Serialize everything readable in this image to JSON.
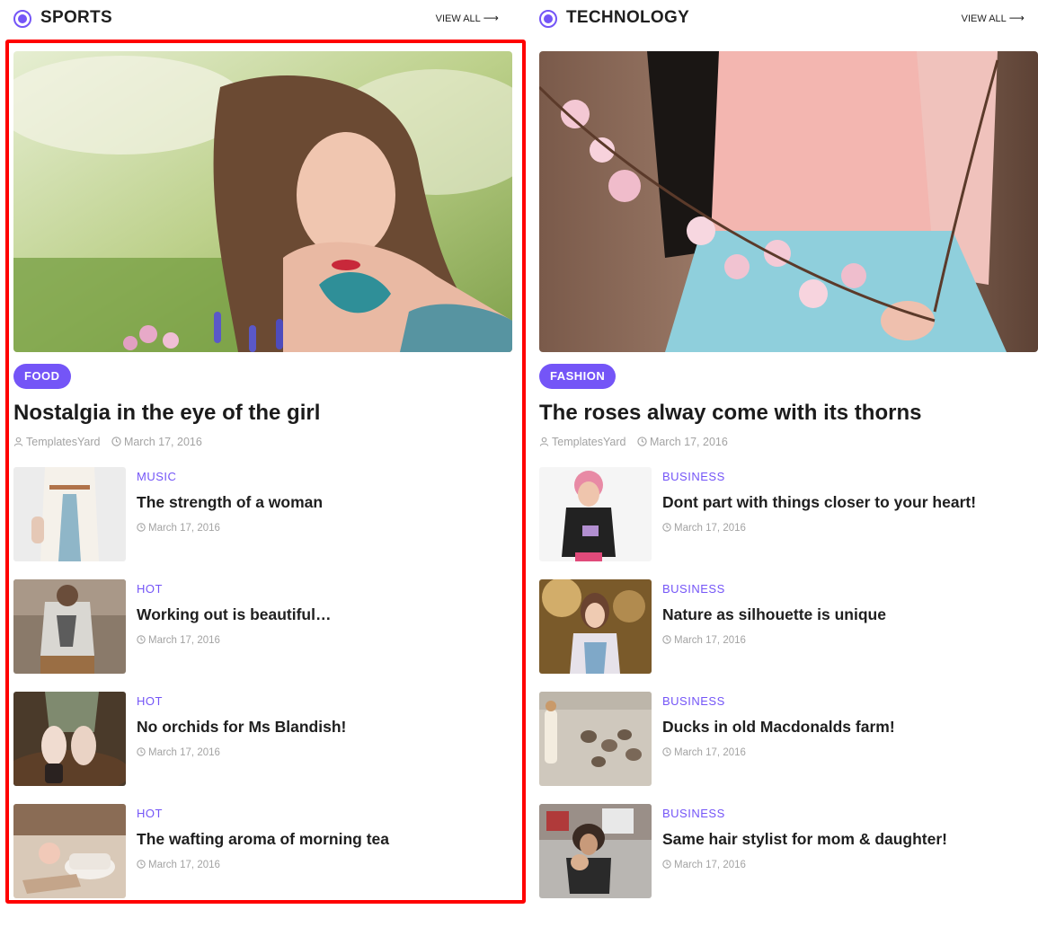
{
  "sections": [
    {
      "title": "SPORTS",
      "view_all": "VIEW ALL",
      "featured": {
        "category": "FOOD",
        "title": "Nostalgia in the eye of the girl",
        "author": "TemplatesYard",
        "date": "March 17, 2016"
      },
      "items": [
        {
          "category": "MUSIC",
          "title": "The strength of a woman",
          "date": "March 17, 2016"
        },
        {
          "category": "HOT",
          "title": "Working out is beautiful…",
          "date": "March 17, 2016"
        },
        {
          "category": "HOT",
          "title": "No orchids for Ms Blandish!",
          "date": "March 17, 2016"
        },
        {
          "category": "HOT",
          "title": "The wafting aroma of morning tea",
          "date": "March 17, 2016"
        }
      ]
    },
    {
      "title": "TECHNOLOGY",
      "view_all": "VIEW ALL",
      "featured": {
        "category": "FASHION",
        "title": "The roses alway come with its thorns",
        "author": "TemplatesYard",
        "date": "March 17, 2016"
      },
      "items": [
        {
          "category": "BUSINESS",
          "title": "Dont part with things closer to your heart!",
          "date": "March 17, 2016"
        },
        {
          "category": "BUSINESS",
          "title": "Nature as silhouette is unique",
          "date": "March 17, 2016"
        },
        {
          "category": "BUSINESS",
          "title": "Ducks in old Macdonalds farm!",
          "date": "March 17, 2016"
        },
        {
          "category": "BUSINESS",
          "title": "Same hair stylist for mom & daughter!",
          "date": "March 17, 2016"
        }
      ]
    }
  ],
  "colors": {
    "accent": "#7455f7",
    "highlight": "#ff0000",
    "meta": "#a3a3a3",
    "text": "#1f1f1f"
  },
  "icons": {
    "section": "radio-dot-icon",
    "view_all": "arrow-right-icon",
    "author": "user-icon",
    "date": "clock-icon"
  }
}
